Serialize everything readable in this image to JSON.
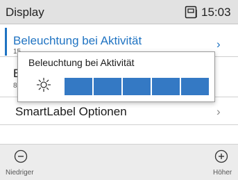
{
  "statusbar": {
    "title": "Display",
    "phone_icon": "handset-display-icon",
    "time": "15:03"
  },
  "menu": {
    "items": [
      {
        "label": "Beleuchtung bei Aktivität",
        "value": "15",
        "selected": true,
        "chevron": "›"
      },
      {
        "label": "B",
        "value": "8"
      },
      {
        "label": "SmartLabel Optionen",
        "chevron": "›"
      }
    ]
  },
  "popup": {
    "title": "Beleuchtung bei Aktivität",
    "icon": "sun-icon",
    "level": {
      "filled": 5,
      "total": 5
    }
  },
  "footer": {
    "decrease_label": "Niedriger",
    "decrease_icon": "minus-circle-icon",
    "increase_label": "Höher",
    "increase_icon": "plus-circle-icon"
  },
  "colors": {
    "accent": "#1f73c2",
    "level_fill": "#3479c4",
    "statusbar_bg": "#e2e2e2",
    "footer_bg": "#ececec"
  }
}
